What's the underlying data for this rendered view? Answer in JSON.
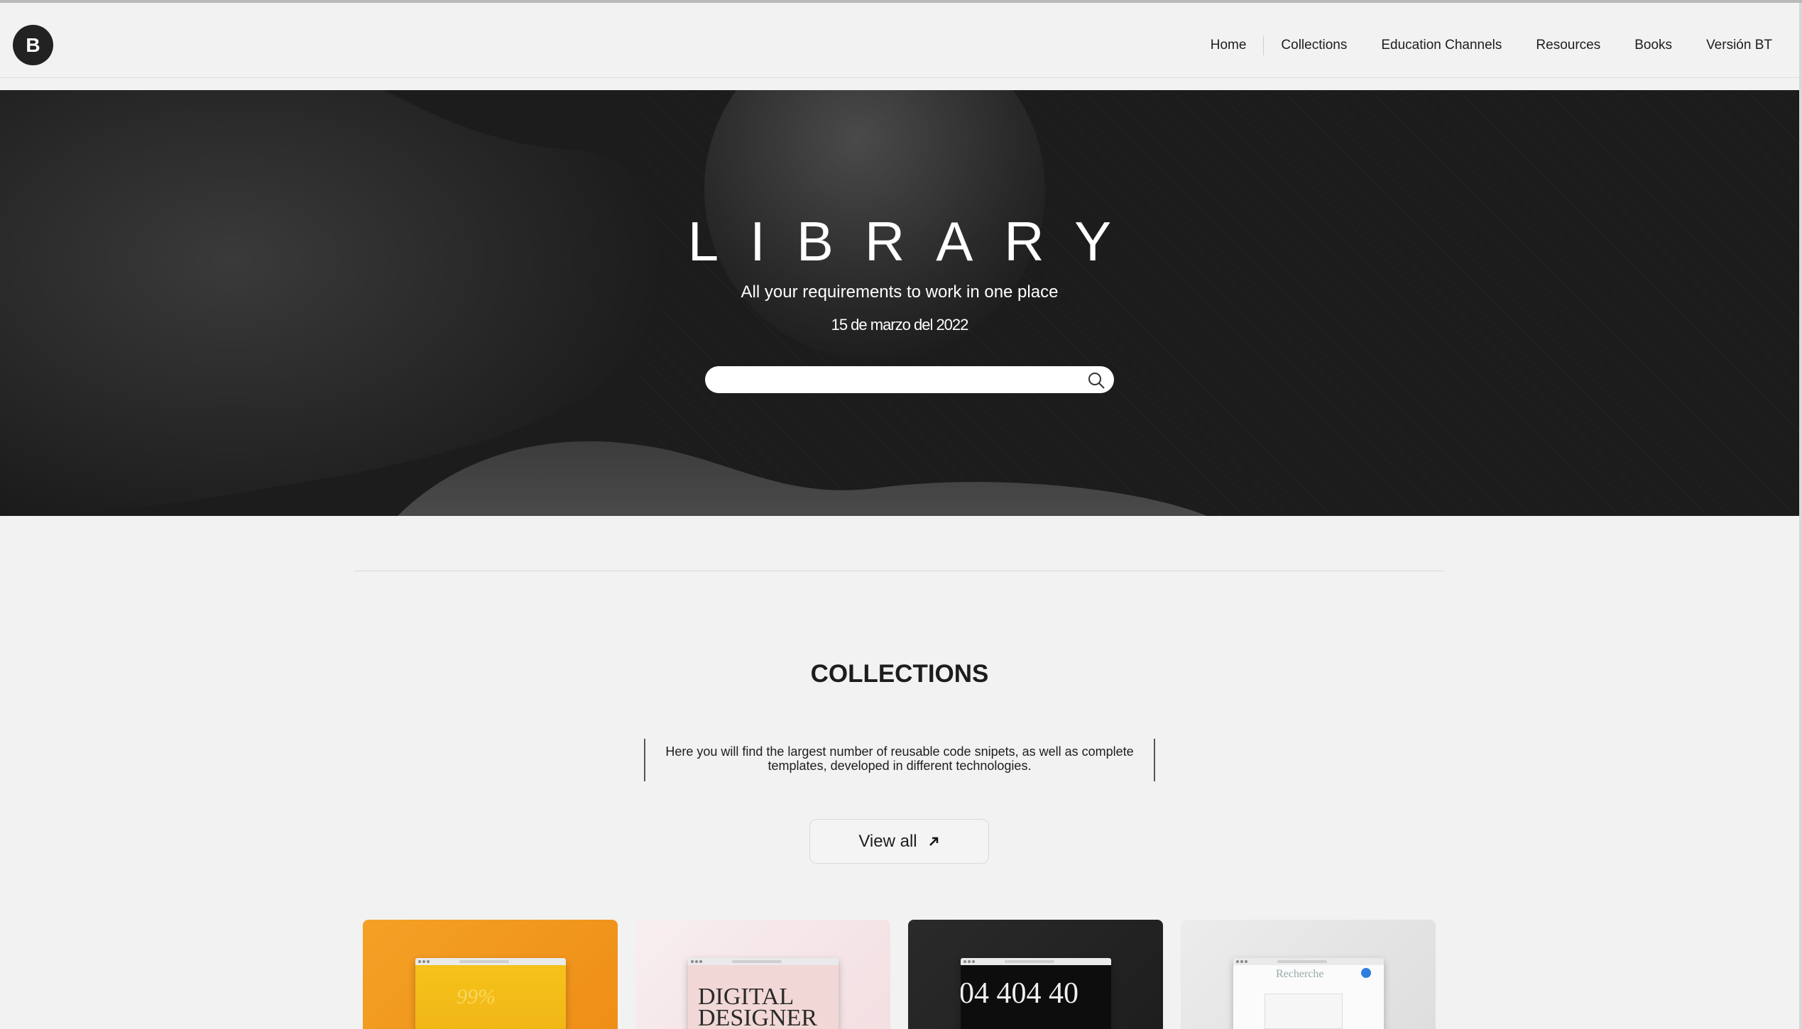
{
  "nav": {
    "logo_letter": "B",
    "items": [
      {
        "label": "Home"
      },
      {
        "label": "Collections"
      },
      {
        "label": "Education Channels"
      },
      {
        "label": "Resources"
      },
      {
        "label": "Books"
      },
      {
        "label": "Versión BT"
      }
    ]
  },
  "hero": {
    "title": "LIBRARY",
    "subtitle": "All your requirements to work in one place",
    "date": "15 de marzo del 2022",
    "search_placeholder": "",
    "search_icon": "search-icon"
  },
  "collections": {
    "title": "COLLECTIONS",
    "description": "Here you will find the largest number of reusable code snipets, as well as complete templates, developed in different technologies.",
    "view_all_label": "View all",
    "view_all_icon": "arrow-up-right-icon",
    "cards": [
      {
        "preview_text": "99%",
        "bg": "#f0951c"
      },
      {
        "preview_text": "DIGITAL DESIGNER",
        "bg": "#f6e3e6"
      },
      {
        "preview_text": "04 404 40",
        "bg": "#232323"
      },
      {
        "preview_text": "Recherche",
        "bg": "#e7e7e7"
      }
    ]
  },
  "colors": {
    "background": "#f2f2f2",
    "hero_bg": "#1c1c1c",
    "text": "#1d1d1d"
  }
}
